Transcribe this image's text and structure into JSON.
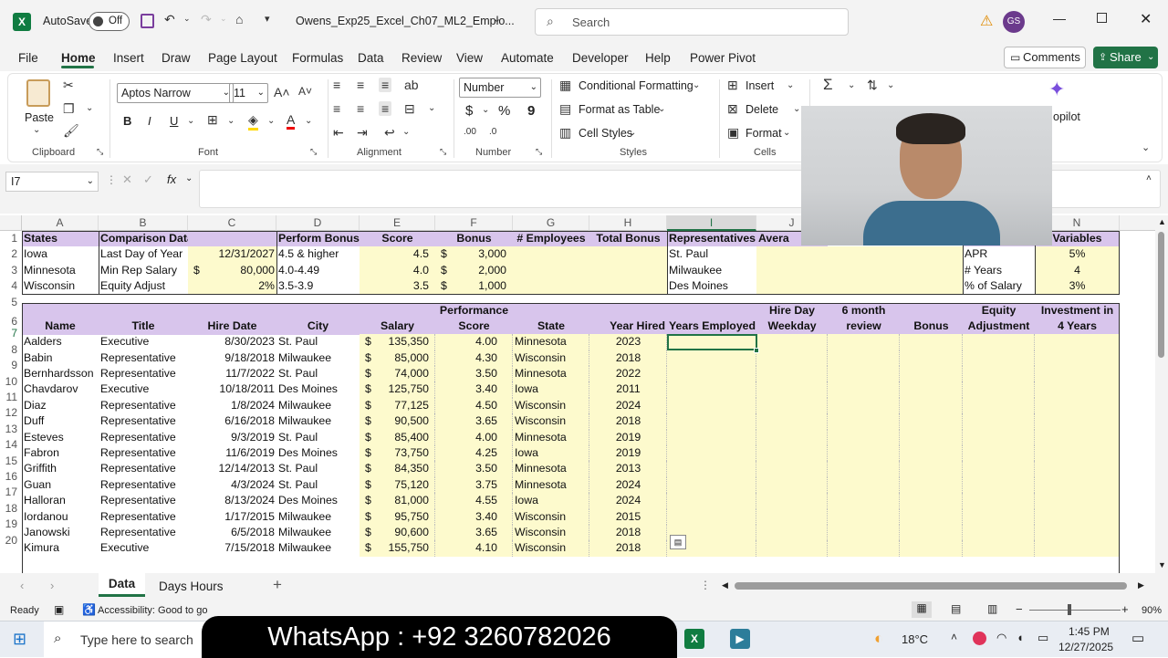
{
  "titlebar": {
    "autosave_label": "AutoSave",
    "autosave_state": "Off",
    "filename": "Owens_Exp25_Excel_Ch07_ML2_Emplo...",
    "search_placeholder": "Search",
    "user_initials": "GS"
  },
  "menu": [
    "File",
    "Home",
    "Insert",
    "Draw",
    "Page Layout",
    "Formulas",
    "Data",
    "Review",
    "View",
    "Automate",
    "Developer",
    "Help",
    "Power Pivot"
  ],
  "menu_active": "Home",
  "comments_label": "Comments",
  "share_label": "Share",
  "ribbon": {
    "clipboard": {
      "paste": "Paste",
      "group": "Clipboard"
    },
    "font": {
      "name": "Aptos Narrow",
      "size": "11",
      "group": "Font",
      "bold": "B",
      "italic": "I",
      "underline": "U"
    },
    "alignment": {
      "group": "Alignment"
    },
    "number": {
      "format": "Number",
      "group": "Number",
      "currency": "$",
      "percent": "%",
      "comma": "9"
    },
    "styles": {
      "cond": "Conditional Formatting",
      "table": "Format as Table",
      "cellstyles": "Cell Styles",
      "group": "Styles"
    },
    "cells": {
      "insert": "Insert",
      "delete": "Delete",
      "format": "Format",
      "group": "Cells"
    },
    "copilot": "opilot"
  },
  "formula_bar": {
    "name_box": "I7",
    "fx": "fx",
    "formula": ""
  },
  "columns": [
    "A",
    "B",
    "C",
    "D",
    "E",
    "F",
    "G",
    "H",
    "I",
    "J",
    "N"
  ],
  "row_numbers": [
    "1",
    "2",
    "3",
    "4",
    "5",
    "6",
    "7",
    "8",
    "9",
    "10",
    "11",
    "12",
    "13",
    "14",
    "15",
    "16",
    "17",
    "18",
    "19",
    "20"
  ],
  "top_table": {
    "headers": [
      "States",
      "Comparison Data",
      "",
      "Perform Bonus",
      "Score",
      "Bonus",
      "# Employees",
      "Total Bonus",
      "Representatives",
      "Avera",
      "Variables"
    ],
    "states": [
      "Iowa",
      "Minnesota",
      "Wisconsin"
    ],
    "comparison_labels": [
      "Last Day of Year",
      "Min Rep Salary",
      "Equity Adjust"
    ],
    "comparison_currency": [
      "",
      "$",
      ""
    ],
    "comparison_values": [
      "12/31/2027",
      "80,000",
      "2%"
    ],
    "perform_bonus": [
      "4.5 & higher",
      "4.0-4.49",
      "3.5-3.9"
    ],
    "scores": [
      "4.5",
      "4.0",
      "3.5"
    ],
    "bonus_currency": [
      "$",
      "$",
      "$"
    ],
    "bonus_values": [
      "3,000",
      "2,000",
      "1,000"
    ],
    "representatives": [
      "St. Paul",
      "Milwaukee",
      "Des Moines"
    ],
    "variable_labels": [
      "APR",
      "# Years",
      "% of Salary"
    ],
    "variable_values": [
      "5%",
      "4",
      "3%"
    ]
  },
  "main_headers": {
    "row5": {
      "perf": "Performance",
      "hireday": "Hire Day",
      "sixmonth": "6 month",
      "equity": "Equity",
      "investment": "Investment in"
    },
    "row6": {
      "name": "Name",
      "title": "Title",
      "hire": "Hire Date",
      "city": "City",
      "salary": "Salary",
      "score": "Score",
      "state": "State",
      "year": "Year Hired",
      "years_employed": "Years Employed",
      "weekday": "Weekday",
      "review": "review",
      "bonus": "Bonus",
      "adjustment": "Adjustment",
      "four_years": "4 Years"
    }
  },
  "employees": [
    {
      "name": "Aalders",
      "title": "Executive",
      "hire": "8/30/2023",
      "city": "St. Paul",
      "cur": "$",
      "salary": "135,350",
      "score": "4.00",
      "state": "Minnesota",
      "year": "2023"
    },
    {
      "name": "Babin",
      "title": "Representative",
      "hire": "9/18/2018",
      "city": "Milwaukee",
      "cur": "$",
      "salary": "85,000",
      "score": "4.30",
      "state": "Wisconsin",
      "year": "2018"
    },
    {
      "name": "Bernhardsson",
      "title": "Representative",
      "hire": "11/7/2022",
      "city": "St. Paul",
      "cur": "$",
      "salary": "74,000",
      "score": "3.50",
      "state": "Minnesota",
      "year": "2022"
    },
    {
      "name": "Chavdarov",
      "title": "Executive",
      "hire": "10/18/2011",
      "city": "Des Moines",
      "cur": "$",
      "salary": "125,750",
      "score": "3.40",
      "state": "Iowa",
      "year": "2011"
    },
    {
      "name": "Diaz",
      "title": "Representative",
      "hire": "1/8/2024",
      "city": "Milwaukee",
      "cur": "$",
      "salary": "77,125",
      "score": "4.50",
      "state": "Wisconsin",
      "year": "2024"
    },
    {
      "name": "Duff",
      "title": "Representative",
      "hire": "6/16/2018",
      "city": "Milwaukee",
      "cur": "$",
      "salary": "90,500",
      "score": "3.65",
      "state": "Wisconsin",
      "year": "2018"
    },
    {
      "name": "Esteves",
      "title": "Representative",
      "hire": "9/3/2019",
      "city": "St. Paul",
      "cur": "$",
      "salary": "85,400",
      "score": "4.00",
      "state": "Minnesota",
      "year": "2019"
    },
    {
      "name": "Fabron",
      "title": "Representative",
      "hire": "11/6/2019",
      "city": "Des Moines",
      "cur": "$",
      "salary": "73,750",
      "score": "4.25",
      "state": "Iowa",
      "year": "2019"
    },
    {
      "name": "Griffith",
      "title": "Representative",
      "hire": "12/14/2013",
      "city": "St. Paul",
      "cur": "$",
      "salary": "84,350",
      "score": "3.50",
      "state": "Minnesota",
      "year": "2013"
    },
    {
      "name": "Guan",
      "title": "Representative",
      "hire": "4/3/2024",
      "city": "St. Paul",
      "cur": "$",
      "salary": "75,120",
      "score": "3.75",
      "state": "Minnesota",
      "year": "2024"
    },
    {
      "name": "Halloran",
      "title": "Representative",
      "hire": "8/13/2024",
      "city": "Des Moines",
      "cur": "$",
      "salary": "81,000",
      "score": "4.55",
      "state": "Iowa",
      "year": "2024"
    },
    {
      "name": "Iordanou",
      "title": "Representative",
      "hire": "1/17/2015",
      "city": "Milwaukee",
      "cur": "$",
      "salary": "95,750",
      "score": "3.40",
      "state": "Wisconsin",
      "year": "2015"
    },
    {
      "name": "Janowski",
      "title": "Representative",
      "hire": "6/5/2018",
      "city": "Milwaukee",
      "cur": "$",
      "salary": "90,600",
      "score": "3.65",
      "state": "Wisconsin",
      "year": "2018"
    },
    {
      "name": "Kimura",
      "title": "Executive",
      "hire": "7/15/2018",
      "city": "Milwaukee",
      "cur": "$",
      "salary": "155,750",
      "score": "4.10",
      "state": "Wisconsin",
      "year": "2018"
    }
  ],
  "sheet_tabs": [
    "Data",
    "Days Hours"
  ],
  "active_tab": "Data",
  "status": {
    "ready": "Ready",
    "accessibility": "Accessibility: Good to go",
    "zoom": "90%"
  },
  "taskbar": {
    "search_placeholder": "Type here to search",
    "temperature": "18°C",
    "time": "1:45 PM",
    "date": "12/27/2025"
  },
  "overlay_banner": "WhatsApp : +92 3260782026",
  "colors": {
    "excel_green": "#217346",
    "purple_header": "#d8c5ec",
    "yellow_fill": "#fdfacd",
    "selected_col": "#e1e1e1"
  }
}
